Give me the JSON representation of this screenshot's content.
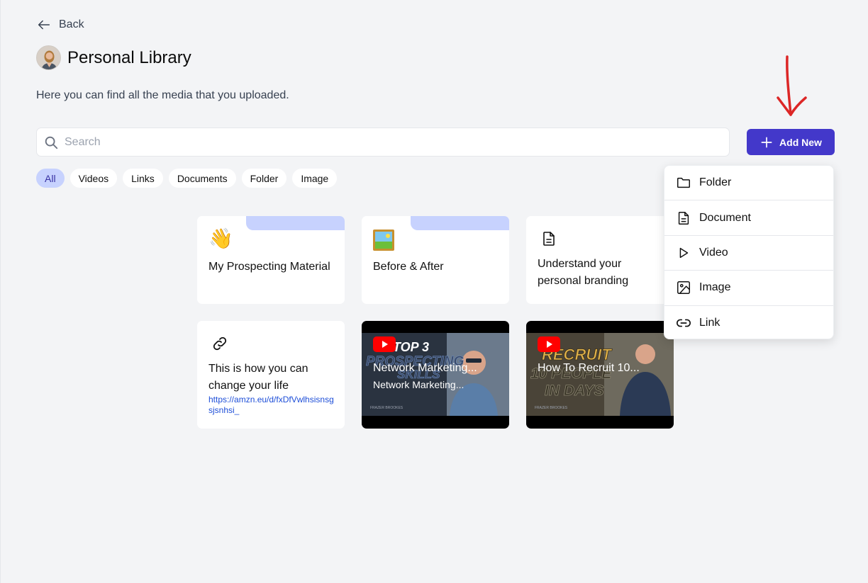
{
  "nav": {
    "back_label": "Back"
  },
  "header": {
    "title": "Personal Library",
    "subtitle": "Here you can find all the media that you uploaded."
  },
  "search": {
    "placeholder": "Search",
    "value": ""
  },
  "add_button": {
    "label": "Add New"
  },
  "filters": [
    "All",
    "Videos",
    "Links",
    "Documents",
    "Folder",
    "Image"
  ],
  "active_filter": "All",
  "cards": [
    {
      "type": "folder",
      "emoji": "👋",
      "title": "My Prospecting Material"
    },
    {
      "type": "folder",
      "emoji": "🖼️",
      "title": "Before & After"
    },
    {
      "type": "document",
      "title": "Understand your personal branding"
    },
    {
      "type": "link",
      "title": "This is how you can change your life",
      "url": "https://amzn.eu/d/fxDfVwlhsisnsgsjsnhsi_"
    }
  ],
  "videos": [
    {
      "title": "Network Marketing...",
      "subtitle": "Network Marketing...",
      "thumb_text": [
        "TOP 3",
        "PROSPECTING",
        "SKILLS"
      ],
      "channel": "FRAZER BROOKES"
    },
    {
      "title": "How To Recruit 10...",
      "thumb_text": [
        "RECRUIT",
        "10 PEOPLE",
        "IN DAYS"
      ],
      "channel": "FRAZER BROOKES"
    }
  ],
  "add_menu": [
    "Folder",
    "Document",
    "Video",
    "Image",
    "Link"
  ],
  "colors": {
    "accent": "#4338ca",
    "chip_active": "#c7d2fe",
    "background": "#f3f4f6",
    "arrow": "#dc2626",
    "youtube": "#ff0000"
  }
}
